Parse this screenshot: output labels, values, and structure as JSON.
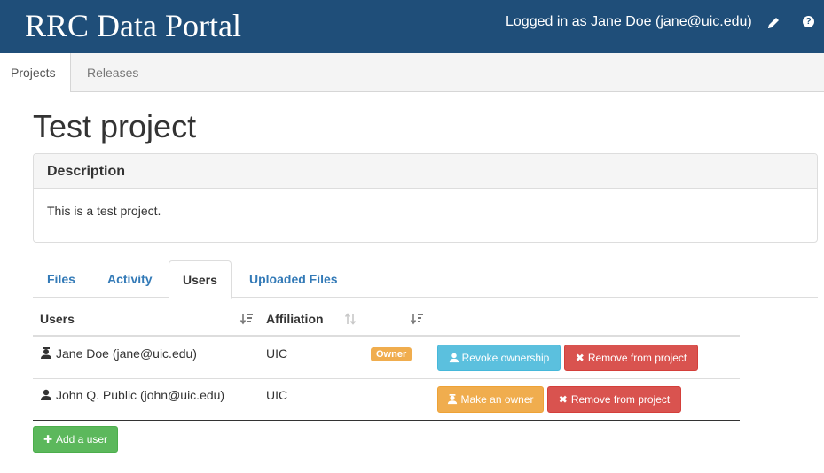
{
  "app": {
    "title": "RRC Data Portal"
  },
  "header": {
    "login_text": "Logged in as Jane Doe (jane@uic.edu)",
    "edit_icon": "pencil-icon",
    "help_icon": "question-circle-icon",
    "help_glyph": "?"
  },
  "nav": {
    "tabs": [
      {
        "label": "Projects",
        "active": true
      },
      {
        "label": "Releases",
        "active": false
      }
    ]
  },
  "page": {
    "title": "Test project"
  },
  "description": {
    "heading": "Description",
    "body": "This is a test project."
  },
  "tabs": [
    {
      "label": "Files",
      "active": false
    },
    {
      "label": "Activity",
      "active": false
    },
    {
      "label": "Users",
      "active": true
    },
    {
      "label": "Uploaded Files",
      "active": false
    }
  ],
  "users_table": {
    "columns": [
      {
        "label": "Users"
      },
      {
        "label": "Affiliation"
      }
    ],
    "rows": [
      {
        "name": "Jane Doe (jane@uic.edu)",
        "affiliation": "UIC",
        "badge": "Owner",
        "icon": "owner-user-icon",
        "actions": [
          {
            "label": "Revoke ownership",
            "icon": "user-icon"
          },
          {
            "label": "Remove from project",
            "icon": "times-icon"
          }
        ]
      },
      {
        "name": "John Q. Public (john@uic.edu)",
        "affiliation": "UIC",
        "badge": "",
        "icon": "user-icon",
        "actions": [
          {
            "label": "Make an owner",
            "icon": "owner-user-icon"
          },
          {
            "label": "Remove from project",
            "icon": "times-icon"
          }
        ]
      }
    ]
  },
  "add_user": {
    "label": "Add a user",
    "icon": "plus-icon"
  },
  "colors": {
    "header_bg": "#1f4e79",
    "link": "#337ab7",
    "info": "#5bc0de",
    "danger": "#d9534f",
    "warning": "#f0ad4e",
    "success": "#5cb85c"
  },
  "glyphs": {
    "times": "✖",
    "plus": "✚"
  }
}
